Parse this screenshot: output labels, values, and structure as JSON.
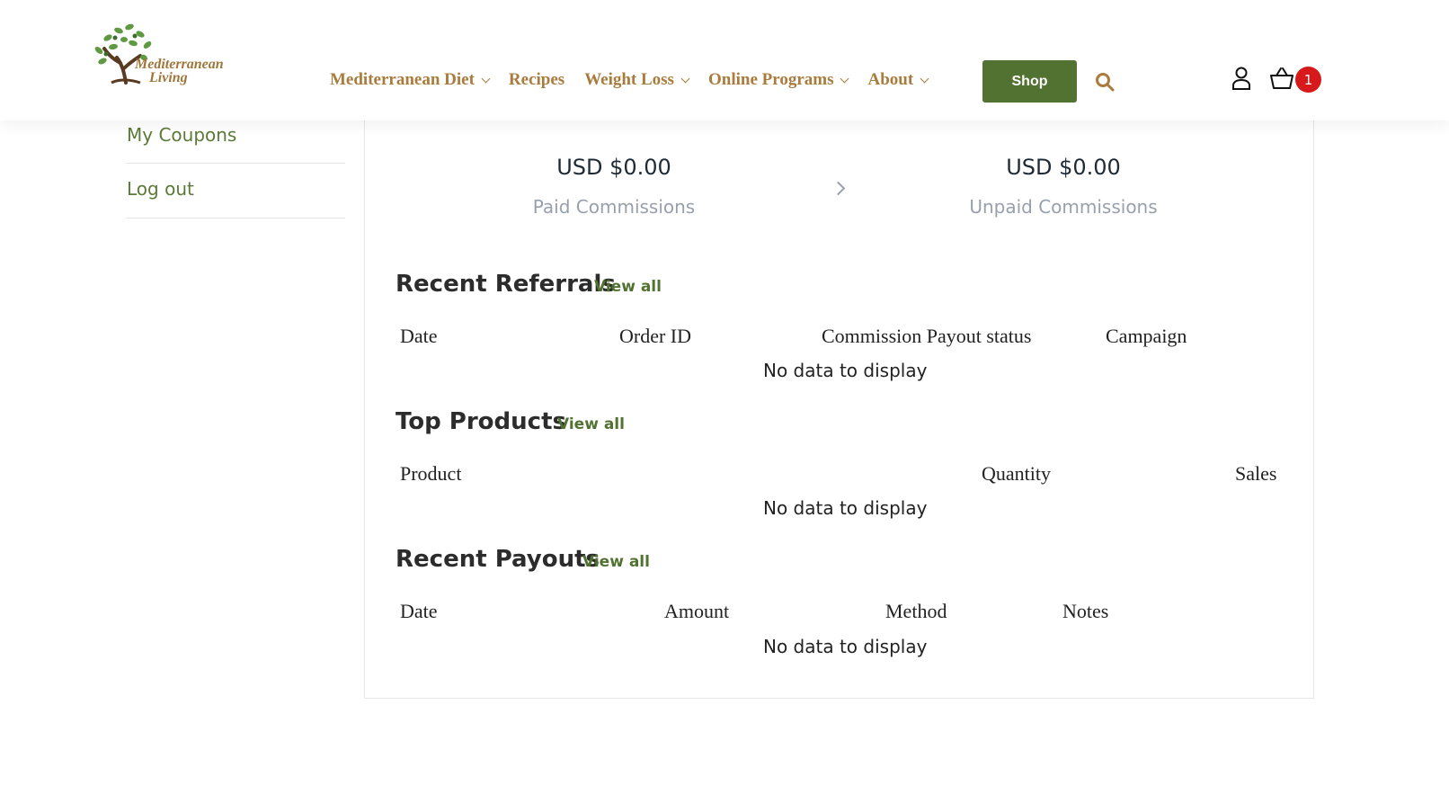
{
  "brand": {
    "logo_line1": "Mediterranean",
    "logo_line2": "Living"
  },
  "nav": {
    "items": [
      {
        "label": "Mediterranean Diet",
        "dropdown": true
      },
      {
        "label": "Recipes",
        "dropdown": false
      },
      {
        "label": "Weight Loss",
        "dropdown": true
      },
      {
        "label": "Online Programs",
        "dropdown": true
      },
      {
        "label": "About",
        "dropdown": true
      }
    ],
    "shop_label": "Shop",
    "cart_count": "1",
    "accent_color": "#527231",
    "nav_color": "#a97b3c"
  },
  "sidebar": {
    "items": [
      {
        "label": "My Coupons"
      },
      {
        "label": "Log out"
      }
    ]
  },
  "stats": {
    "paid": {
      "amount": "USD $0.00",
      "label": "Paid Commissions"
    },
    "unpaid": {
      "amount": "USD $0.00",
      "label": "Unpaid Commissions"
    }
  },
  "sections": {
    "referrals": {
      "title": "Recent Referrals",
      "view_all": "View all",
      "columns": [
        "Date",
        "Order ID",
        "Commission Payout status",
        "Campaign"
      ],
      "empty": "No data to display"
    },
    "products": {
      "title": "Top Products",
      "view_all": "View all",
      "columns": [
        "Product",
        "Quantity",
        "Sales"
      ],
      "empty": "No data to display"
    },
    "payouts": {
      "title": "Recent Payouts",
      "view_all": "View all",
      "columns": [
        "Date",
        "Amount",
        "Method",
        "Notes"
      ],
      "empty": "No data to display"
    }
  }
}
